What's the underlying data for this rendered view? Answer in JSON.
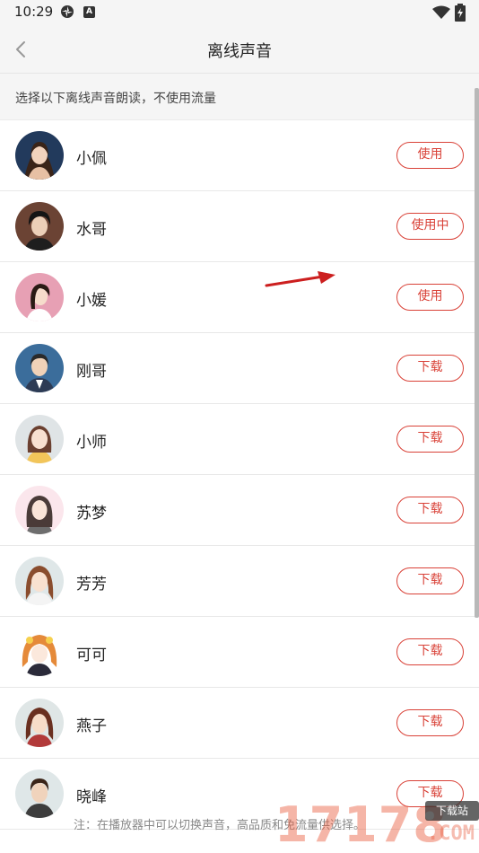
{
  "status_bar": {
    "time": "10:29",
    "icons": [
      "gear-icon",
      "a-notification-icon",
      "wifi-icon",
      "battery-charging-icon"
    ]
  },
  "header": {
    "title": "离线声音",
    "back_icon": "chevron-left-icon"
  },
  "subtitle": "选择以下离线声音朗读，不使用流量",
  "voices": [
    {
      "name": "小佩",
      "action": "使用"
    },
    {
      "name": "水哥",
      "action": "使用中"
    },
    {
      "name": "小媛",
      "action": "使用"
    },
    {
      "name": "刚哥",
      "action": "下载"
    },
    {
      "name": "小师",
      "action": "下载"
    },
    {
      "name": "苏梦",
      "action": "下载"
    },
    {
      "name": "芳芳",
      "action": "下载"
    },
    {
      "name": "可可",
      "action": "下载"
    },
    {
      "name": "燕子",
      "action": "下载"
    },
    {
      "name": "晓峰",
      "action": "下载"
    }
  ],
  "footer_note": "注：在播放器中可以切换声音，高品质和免流量供选择。",
  "watermark": {
    "digits": "17178",
    "badge": "下载站",
    "suffix": ".COM"
  },
  "colors": {
    "accent": "#d94238",
    "background": "#f5f5f5",
    "annotation_arrow": "#cc1f1f"
  }
}
